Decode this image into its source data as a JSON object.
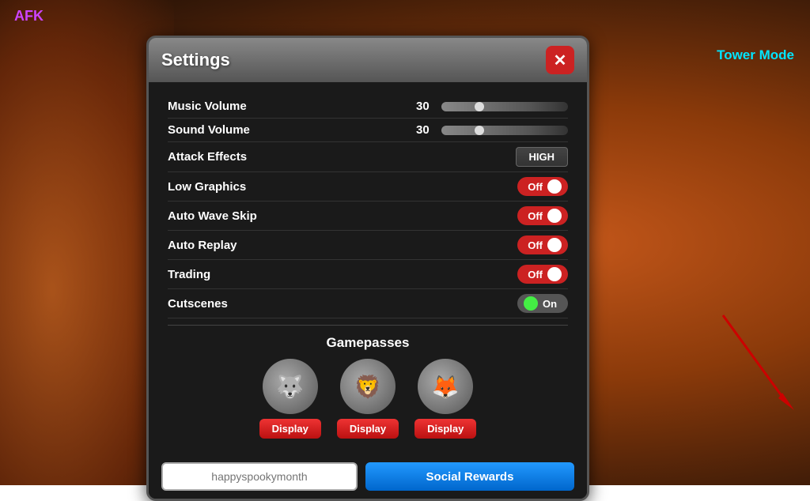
{
  "labels": {
    "afk": "AFK",
    "tower_mode": "Tower Mode",
    "settings_title": "Settings",
    "close": "✕",
    "music_volume": "Music Volume",
    "music_volume_val": "30",
    "sound_volume": "Sound Volume",
    "sound_volume_val": "30",
    "attack_effects": "Attack Effects",
    "attack_effects_value": "HIGH",
    "low_graphics": "Low Graphics",
    "low_graphics_value": "Off",
    "auto_wave_skip": "Auto Wave Skip",
    "auto_wave_skip_value": "Off",
    "auto_replay": "Auto Replay",
    "auto_replay_value": "Off",
    "trading": "Trading",
    "trading_value": "Off",
    "cutscenes": "Cutscenes",
    "cutscenes_value": "On",
    "gamepasses": "Gamepasses",
    "display1": "Display",
    "display2": "Display",
    "display3": "Display",
    "code_placeholder": "happyspookymonth",
    "social_rewards": "Social Rewards"
  }
}
